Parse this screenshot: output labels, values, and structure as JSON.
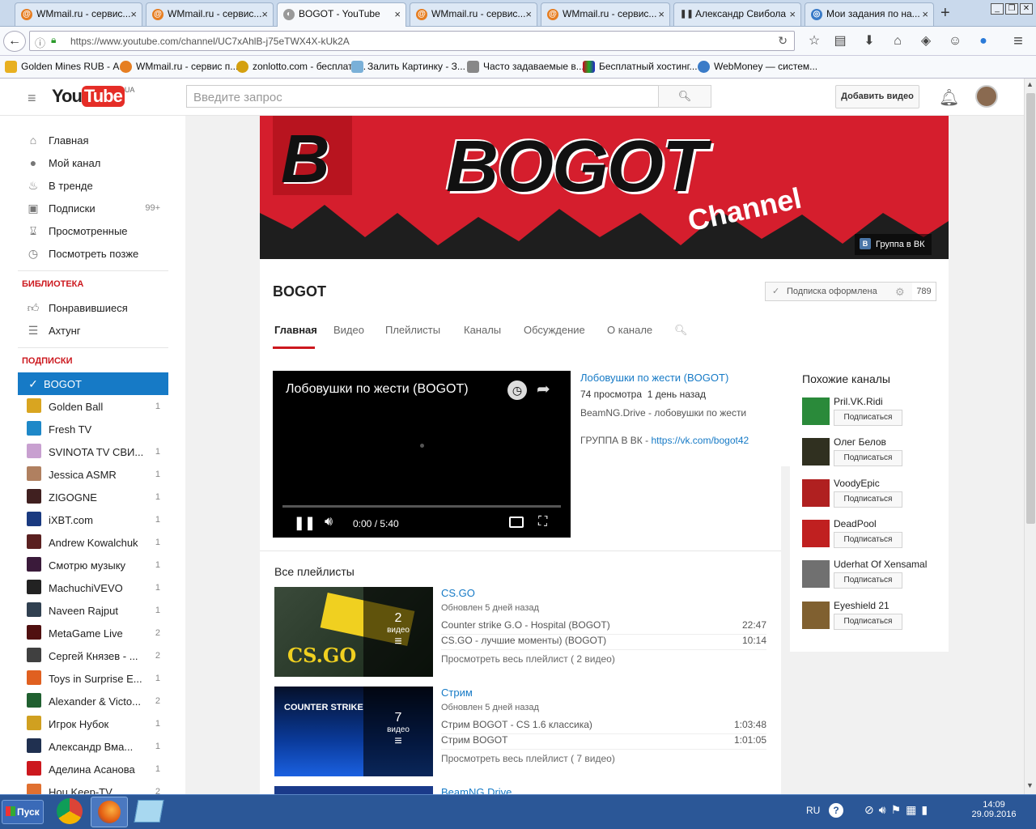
{
  "browser": {
    "tabs": [
      {
        "title": "WMmail.ru - сервис..."
      },
      {
        "title": "WMmail.ru - сервис..."
      },
      {
        "title": "BOGOT - YouTube"
      },
      {
        "title": "WMmail.ru - сервис..."
      },
      {
        "title": "WMmail.ru - сервис..."
      },
      {
        "title": "Александр Свибола"
      },
      {
        "title": "Мои задания по на..."
      }
    ],
    "url": "https://www.youtube.com/channel/UC7xAhlB-j75eTWX4X-kUk2A",
    "bookmarks": [
      {
        "label": "Golden Mines RUB - А..."
      },
      {
        "label": "WMmail.ru - сервис п..."
      },
      {
        "label": "zonlotto.com - бесплатн..."
      },
      {
        "label": "Залить Картинку - З..."
      },
      {
        "label": "Часто задаваемые в..."
      },
      {
        "label": "Бесплатный хостинг..."
      },
      {
        "label": "WebMoney — систем..."
      }
    ]
  },
  "yt": {
    "logo_you": "You",
    "logo_tube": "Tube",
    "country": "UA",
    "search_placeholder": "Введите запрос",
    "add_video": "Добавить видео"
  },
  "sidebar": {
    "nav": [
      {
        "label": "Главная",
        "icon": "home-icon"
      },
      {
        "label": "Мой канал",
        "icon": "user-icon"
      },
      {
        "label": "В тренде",
        "icon": "flame-icon"
      },
      {
        "label": "Подписки",
        "icon": "subscriptions-icon",
        "count": "99+"
      },
      {
        "label": "Просмотренные",
        "icon": "hourglass-icon"
      },
      {
        "label": "Посмотреть позже",
        "icon": "clock-icon"
      }
    ],
    "library_title": "БИБЛИОТЕКА",
    "library": [
      {
        "label": "Понравившиеся",
        "icon": "thumbs-up-icon"
      },
      {
        "label": "Ахтунг",
        "icon": "list-icon"
      }
    ],
    "subs_title": "ПОДПИСКИ",
    "subs": [
      {
        "label": "BOGOT",
        "count": "",
        "color": "#d51e2d",
        "active": true
      },
      {
        "label": "Golden Ball",
        "count": "1",
        "color": "#d9a520"
      },
      {
        "label": "Fresh TV",
        "count": "",
        "color": "#1e88c8"
      },
      {
        "label": "SVINOTA TV СВИ...",
        "count": "1",
        "color": "#c8a0d0"
      },
      {
        "label": "Jessica ASMR",
        "count": "1",
        "color": "#b08060"
      },
      {
        "label": "ZIGOGNE",
        "count": "1",
        "color": "#402020"
      },
      {
        "label": "iXBT.com",
        "count": "1",
        "color": "#1a3a80"
      },
      {
        "label": "Andrew Kowalchuk",
        "count": "1",
        "color": "#5a2020"
      },
      {
        "label": "Смотрю музыку",
        "count": "1",
        "color": "#3a1a3a"
      },
      {
        "label": "MachuchiVEVO",
        "count": "1",
        "color": "#222222"
      },
      {
        "label": "Naveen Rajput",
        "count": "1",
        "color": "#304050"
      },
      {
        "label": "MetaGame Live",
        "count": "2",
        "color": "#501010"
      },
      {
        "label": "Сергей Князев - ...",
        "count": "2",
        "color": "#404040"
      },
      {
        "label": "Toys in Surprise E...",
        "count": "1",
        "color": "#e06020"
      },
      {
        "label": "Alexander & Victo...",
        "count": "2",
        "color": "#206030"
      },
      {
        "label": "Игрок Нубок",
        "count": "1",
        "color": "#d0a020"
      },
      {
        "label": "Александр Вма...",
        "count": "1",
        "color": "#203050"
      },
      {
        "label": "Аделина Асанова",
        "count": "1",
        "color": "#cc181e"
      },
      {
        "label": "Hou Keep-TV",
        "count": "2",
        "color": "#e07030"
      }
    ]
  },
  "channel": {
    "banner_letter": "B",
    "banner_title": "BOGOT",
    "banner_sub": "Channel",
    "vk_link": "Группа в ВК",
    "name": "BOGOT",
    "subscribed_label": "Подписка оформлена",
    "sub_count": "789",
    "tabs": [
      "Главная",
      "Видео",
      "Плейлисты",
      "Каналы",
      "Обсуждение",
      "О канале"
    ]
  },
  "featured": {
    "player_title": "Лобовушки по жести (BOGOT)",
    "time": "0:00 / 5:40",
    "title": "Лобовушки по жести (BOGOT)",
    "views": "74 просмотра",
    "ago": "1 день назад",
    "desc": "BeamNG.Drive - лобовушки по жести",
    "group_prefix": "ГРУППА В ВК - ",
    "group_link": "https://vk.com/bogot42"
  },
  "playlists": {
    "heading": "Все плейлисты",
    "items": [
      {
        "title": "CS.GO",
        "updated": "Обновлен 5 дней назад",
        "count": "2",
        "count_label": "видео",
        "thumb_text": "CS.GO",
        "videos": [
          {
            "t": "Counter strike G.O - Hospital (BOGOT)",
            "d": "22:47"
          },
          {
            "t": "CS.GO - лучшие моменты) (BOGOT)",
            "d": "10:14"
          }
        ],
        "all": "Просмотреть весь плейлист ( 2 видео)"
      },
      {
        "title": "Стрим",
        "updated": "Обновлен 5 дней назад",
        "count": "7",
        "count_label": "видео",
        "thumb_text": "COUNTER STRIKE",
        "videos": [
          {
            "t": "Стрим BOGOT - CS 1.6 классика)",
            "d": "1:03:48"
          },
          {
            "t": "Стрим BOGOT",
            "d": "1:01:05"
          }
        ],
        "all": "Просмотреть весь плейлист ( 7 видео)"
      },
      {
        "title": "BeamNG Drive"
      }
    ]
  },
  "related": {
    "heading": "Похожие каналы",
    "btn": "Подписаться",
    "items": [
      {
        "name": "Pril.VK.Ridi",
        "color": "#2a8a3a"
      },
      {
        "name": "Олег Белов",
        "color": "#303020"
      },
      {
        "name": "VoodyEpic",
        "color": "#b02020"
      },
      {
        "name": "DeadPool",
        "color": "#c02020"
      },
      {
        "name": "Uderhat Of Xensamal",
        "color": "#707070"
      },
      {
        "name": "Eyeshield 21",
        "color": "#806030"
      }
    ]
  },
  "taskbar": {
    "start": "Пуск",
    "lang": "RU",
    "time": "14:09",
    "date": "29.09.2016"
  }
}
